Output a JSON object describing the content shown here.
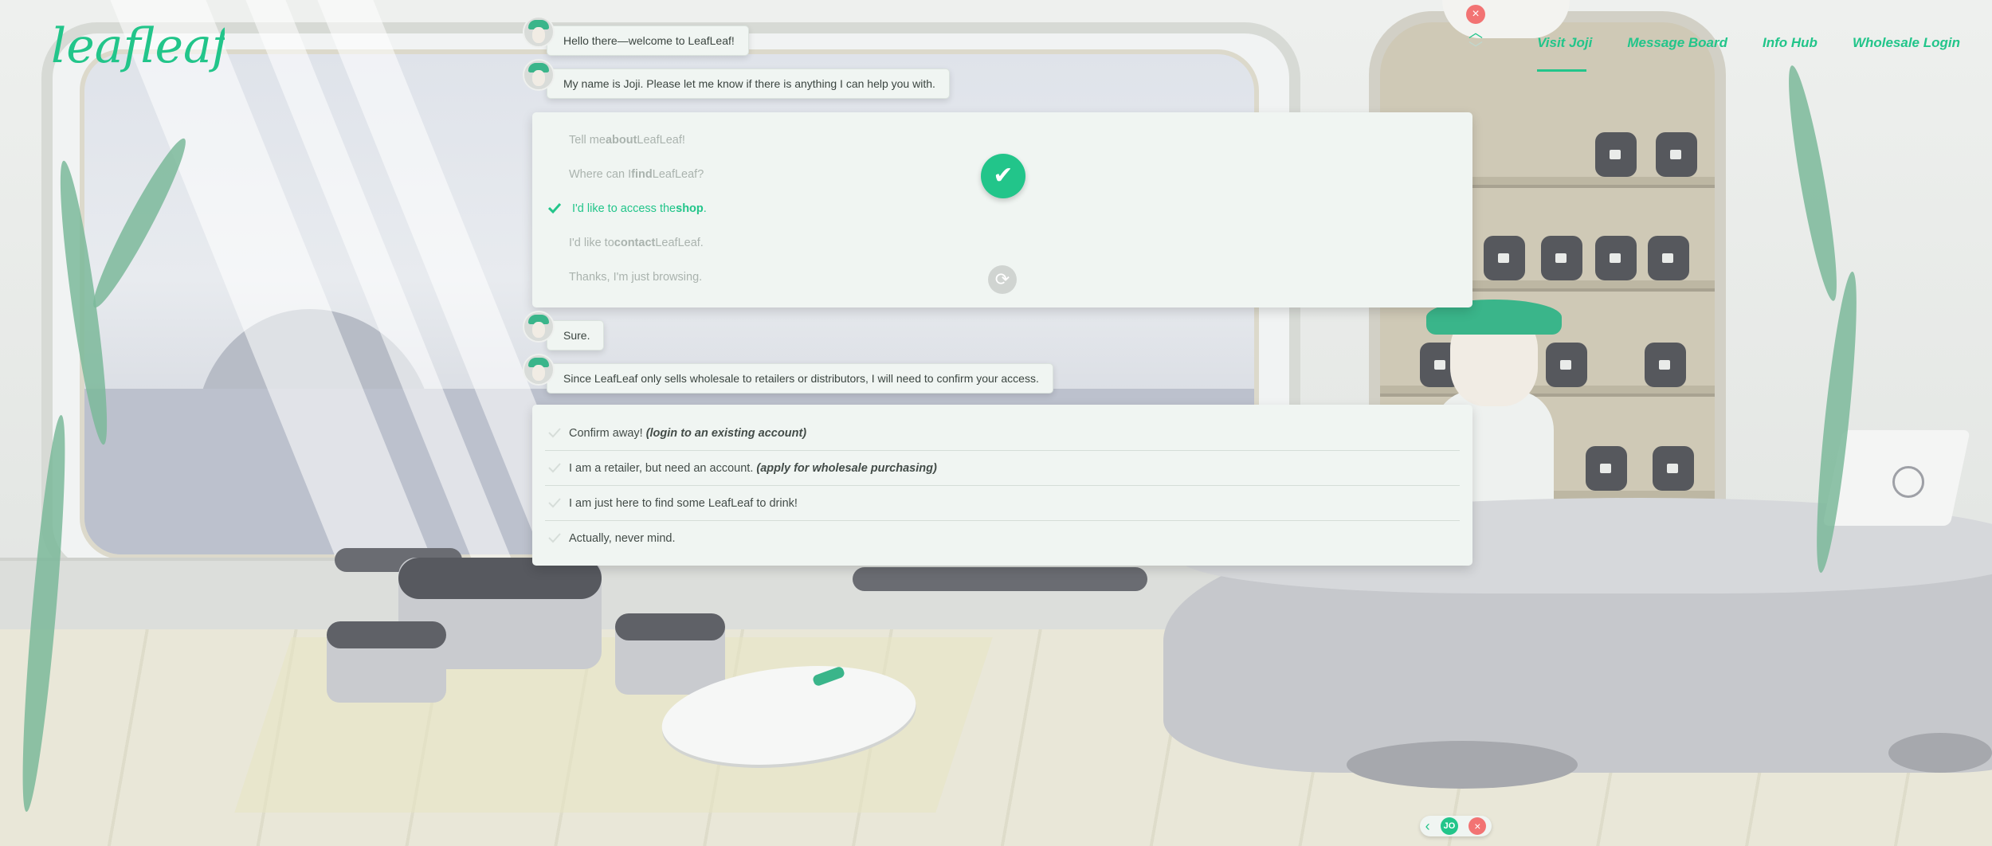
{
  "brand": {
    "logo_text": "leafleaf"
  },
  "nav": [
    {
      "label": "Visit Joji",
      "active": true
    },
    {
      "label": "Message Board",
      "active": false
    },
    {
      "label": "Info Hub",
      "active": false
    },
    {
      "label": "Wholesale Login",
      "active": false
    }
  ],
  "colors": {
    "accent": "#22c58a",
    "close": "#f27373",
    "panel": "#f0f5f2"
  },
  "chat": {
    "greeting": "Hello there—welcome to LeafLeaf!",
    "intro": "My name is Joji. Please let me know if there is anything I can help you with.",
    "first_options": [
      {
        "pre": "Tell me ",
        "bold": "about",
        "post": " LeafLeaf!"
      },
      {
        "pre": "Where can I ",
        "bold": "find",
        "post": " LeafLeaf?"
      },
      {
        "pre": "I'd like to access the ",
        "bold": "shop",
        "post": "."
      },
      {
        "pre": "I'd like to ",
        "bold": "contact",
        "post": " LeafLeaf."
      },
      {
        "pre": "Thanks, I'm just browsing.",
        "bold": "",
        "post": ""
      }
    ],
    "selected_option_index": 2,
    "reply": "Sure.",
    "explanation": "Since LeafLeaf only sells wholesale to retailers or distributors, I will need to confirm your access.",
    "second_options": [
      {
        "text": "Confirm away! ",
        "em": "(login to an existing account)"
      },
      {
        "text": "I am a retailer, but need an account. ",
        "em": "(apply for wholesale purchasing)"
      },
      {
        "text": "I am just here to find some LeafLeaf to drink!",
        "em": ""
      },
      {
        "text": "Actually, never mind.",
        "em": ""
      }
    ]
  },
  "icons": {
    "confirm": "checkmark-icon",
    "redo": "redo-icon",
    "close": "close-icon",
    "scroll_up": "chevron-up-icon",
    "scroll_down": "chevron-down-icon",
    "back": "chevron-left-icon",
    "avatar": "joji-avatar"
  },
  "bottom_badge": "JO"
}
